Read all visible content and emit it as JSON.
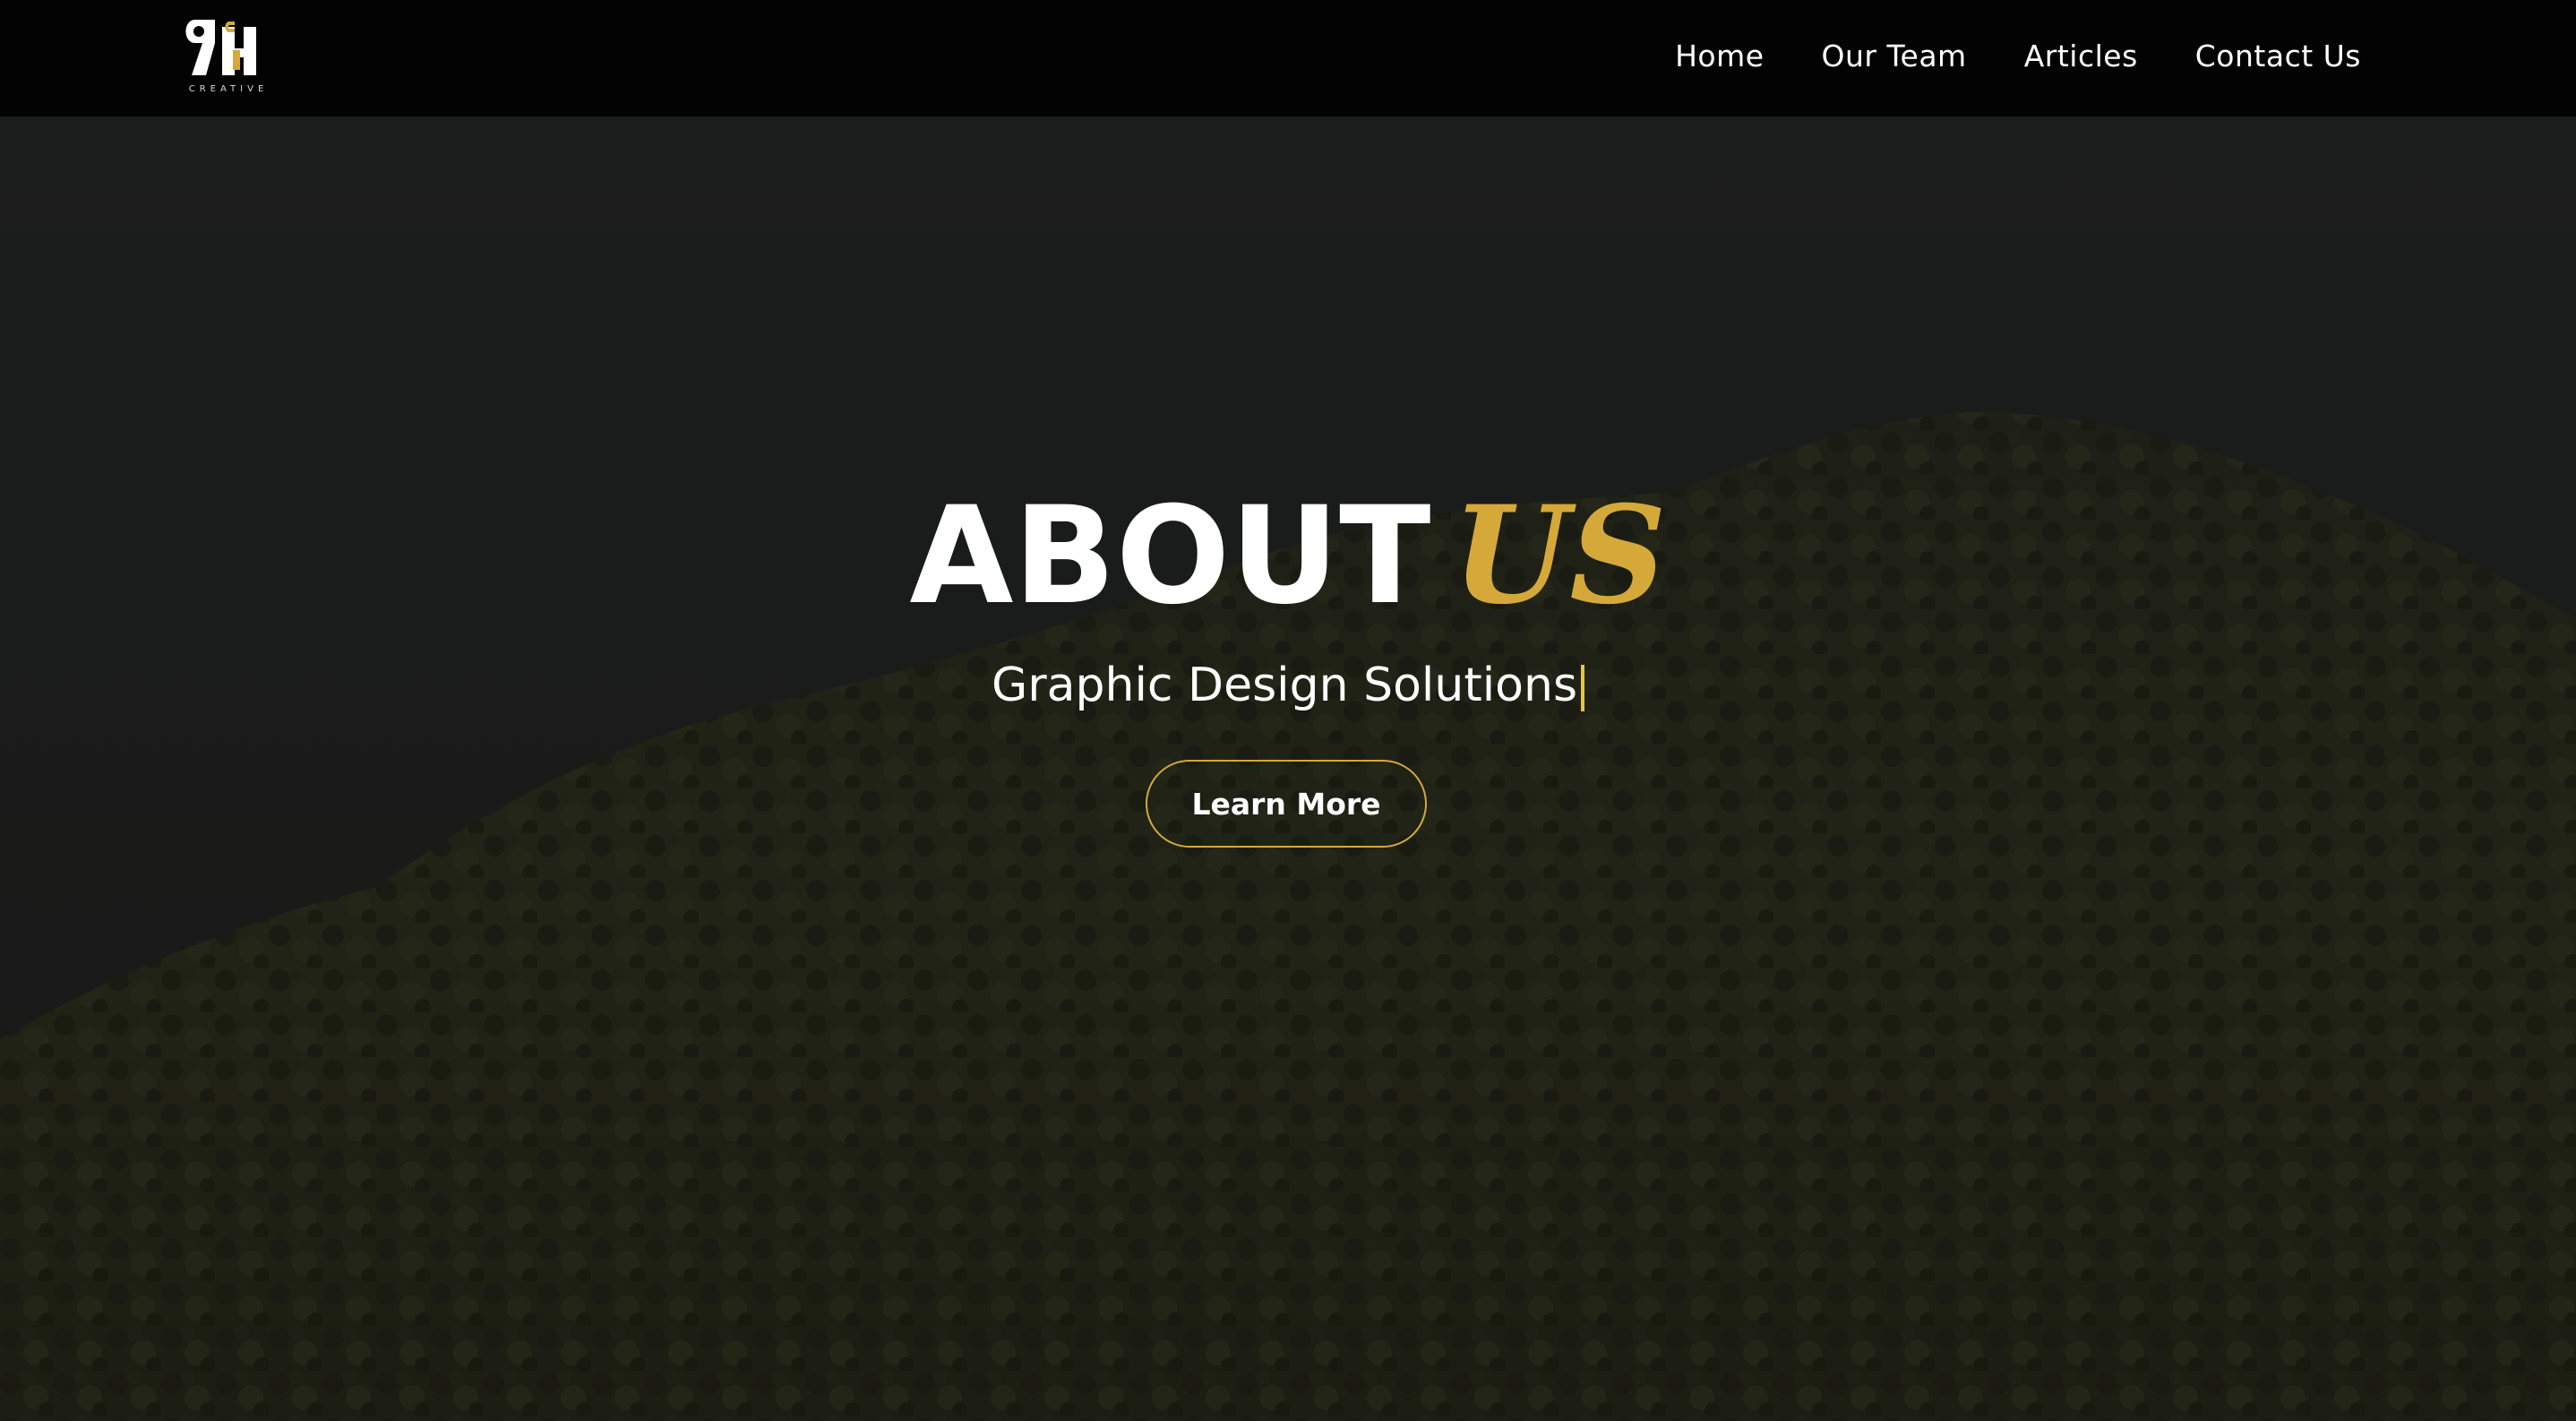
{
  "brand": {
    "logo_icon": "rh-creative-logo-icon",
    "logo_text": "CREATIVE"
  },
  "nav": {
    "items": [
      {
        "label": "Home"
      },
      {
        "label": "Our Team"
      },
      {
        "label": "Articles"
      },
      {
        "label": "Contact Us"
      }
    ]
  },
  "hero": {
    "title_main": "ABOUT",
    "title_accent": "US",
    "subtitle": "Graphic Design Solutions",
    "button_label": "Learn More",
    "background_image": "forested-hill-night-photo"
  },
  "colors": {
    "header_bg": "#030303",
    "accent_gold": "#d4a93a",
    "text_white": "#ffffff",
    "hero_overlay": "#1c1e1f"
  }
}
